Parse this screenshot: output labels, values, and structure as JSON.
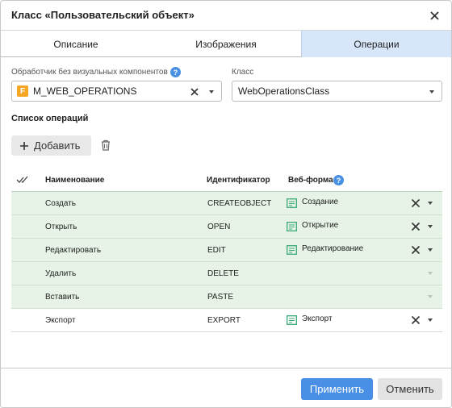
{
  "dialog": {
    "title": "Класс «Пользовательский объект»"
  },
  "tabs": [
    {
      "label": "Описание",
      "active": false
    },
    {
      "label": "Изображения",
      "active": false
    },
    {
      "label": "Операции",
      "active": true
    }
  ],
  "handler": {
    "label": "Обработчик без визуальных компонентов",
    "badge": "F",
    "value": "M_WEB_OPERATIONS"
  },
  "class_field": {
    "label": "Класс",
    "value": "WebOperationsClass"
  },
  "operations": {
    "section_title": "Список операций",
    "add_label": "Добавить",
    "columns": {
      "name": "Наименование",
      "id": "Идентификатор",
      "form": "Веб-форма"
    },
    "rows": [
      {
        "name": "Создать",
        "id": "CREATEOBJECT",
        "form": "Создание",
        "checked": true
      },
      {
        "name": "Открыть",
        "id": "OPEN",
        "form": "Открытие",
        "checked": true
      },
      {
        "name": "Редактировать",
        "id": "EDIT",
        "form": "Редактирование",
        "checked": true
      },
      {
        "name": "Удалить",
        "id": "DELETE",
        "form": "",
        "checked": true
      },
      {
        "name": "Вставить",
        "id": "PASTE",
        "form": "",
        "checked": true
      },
      {
        "name": "Экспорт",
        "id": "EXPORT",
        "form": "Экспорт",
        "checked": false
      }
    ]
  },
  "footer": {
    "apply_label": "Применить",
    "cancel_label": "Отменить"
  },
  "colors": {
    "accent": "#4a8fe6",
    "active_tab": "#d7e6f9",
    "checked_row": "#e6f3e6",
    "handler_badge": "#f5a623",
    "form_icon": "#3aa876"
  },
  "icons": {
    "close": "close-icon",
    "help": "help-icon",
    "clear": "clear-icon",
    "dropdown": "chevron-down-icon",
    "add": "plus-icon",
    "delete": "trash-icon",
    "select_all": "select-all-checkmark-icon",
    "web_form": "web-form-icon"
  }
}
